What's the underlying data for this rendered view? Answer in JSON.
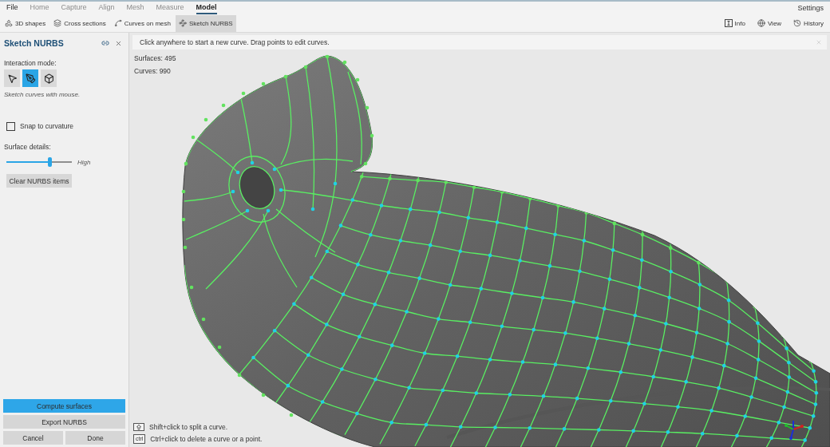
{
  "menu": {
    "items": [
      {
        "label": "File",
        "disabled": false,
        "selected": false
      },
      {
        "label": "Home",
        "disabled": true,
        "selected": false
      },
      {
        "label": "Capture",
        "disabled": true,
        "selected": false
      },
      {
        "label": "Align",
        "disabled": true,
        "selected": false
      },
      {
        "label": "Mesh",
        "disabled": true,
        "selected": false
      },
      {
        "label": "Measure",
        "disabled": true,
        "selected": false
      },
      {
        "label": "Model",
        "disabled": false,
        "selected": true
      }
    ],
    "settings": "Settings"
  },
  "ribbon": {
    "tools": [
      {
        "label": "3D shapes",
        "selected": false
      },
      {
        "label": "Cross sections",
        "selected": false
      },
      {
        "label": "Curves on mesh",
        "selected": false
      },
      {
        "label": "Sketch NURBS",
        "selected": true
      }
    ],
    "right": [
      {
        "label": "Info"
      },
      {
        "label": "View"
      },
      {
        "label": "History"
      }
    ]
  },
  "panel": {
    "title": "Sketch NURBS",
    "interaction_label": "Interaction mode:",
    "modes": [
      {
        "selected": false
      },
      {
        "selected": true
      },
      {
        "selected": false
      }
    ],
    "mode_hint": "Sketch curves with mouse.",
    "snap": {
      "label": "Snap to curvature",
      "checked": false
    },
    "surface_details": {
      "label": "Surface details:",
      "level": 0.66,
      "reading": "High"
    },
    "clear_button": "Clear NURBS items",
    "actions": [
      {
        "label": "Compute surfaces",
        "primary": true
      },
      {
        "label": "Export NURBS",
        "primary": false
      }
    ],
    "footer_buttons": [
      {
        "label": "Cancel"
      },
      {
        "label": "Done"
      }
    ]
  },
  "viewport": {
    "hint": "Click anywhere to start a new curve. Drag points to edit curves.",
    "stats": [
      "Surfaces: 495",
      "Curves: 990"
    ],
    "shortcuts": [
      {
        "kind": "shift_key",
        "text": "Shift+click to split a curve."
      },
      {
        "kind": "text_key",
        "key": "ctrl",
        "text": "Ctrl+click to delete a curve or a point."
      }
    ]
  }
}
